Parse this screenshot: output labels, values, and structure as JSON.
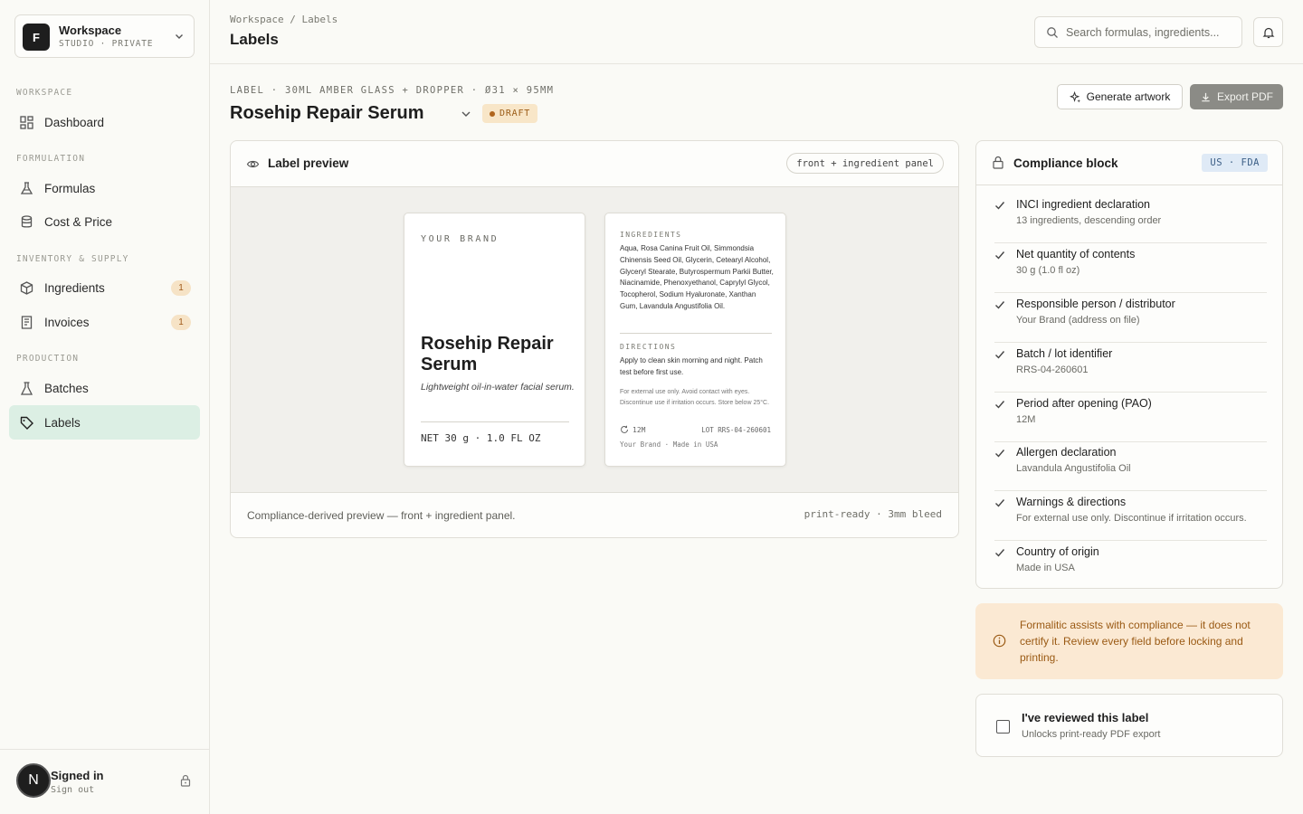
{
  "workspace": {
    "logo_letter": "F",
    "name": "Workspace",
    "subtitle": "STUDIO · PRIVATE"
  },
  "sidebar": {
    "sections": [
      {
        "label": "WORKSPACE"
      },
      {
        "label": "FORMULATION"
      },
      {
        "label": "INVENTORY & SUPPLY"
      },
      {
        "label": "PRODUCTION"
      }
    ],
    "items": [
      {
        "label": "Dashboard",
        "icon": "grid-icon"
      },
      {
        "label": "Formulas",
        "icon": "flask-icon"
      },
      {
        "label": "Cost & Price",
        "icon": "database-icon"
      },
      {
        "label": "Ingredients",
        "icon": "box-icon",
        "badge": "1"
      },
      {
        "label": "Invoices",
        "icon": "receipt-icon",
        "badge": "1"
      },
      {
        "label": "Batches",
        "icon": "beaker-icon"
      },
      {
        "label": "Labels",
        "icon": "tag-icon",
        "active": true
      }
    ],
    "footer": {
      "avatar_letter": "N",
      "status": "Signed in",
      "action": "Sign out"
    }
  },
  "header": {
    "breadcrumb": "Workspace / Labels",
    "title": "Labels",
    "search_placeholder": "Search formulas, ingredients..."
  },
  "label": {
    "meta": "LABEL · 30ML AMBER GLASS + DROPPER · Ø31 × 95MM",
    "name": "Rosehip Repair Serum",
    "status": "DRAFT",
    "generate_label": "Generate artwork",
    "export_label": "Export PDF"
  },
  "preview": {
    "title": "Label preview",
    "pill": "front + ingredient panel",
    "front": {
      "brand": "YOUR BRAND",
      "product": "Rosehip Repair Serum",
      "description": "Lightweight oil-in-water facial serum.",
      "net": "NET 30 g · 1.0 FL OZ"
    },
    "back": {
      "ingredients_heading": "INGREDIENTS",
      "ingredients": "Aqua, Rosa Canina Fruit Oil, Simmondsia Chinensis Seed Oil, Glycerin, Cetearyl Alcohol, Glyceryl Stearate, Butyrospermum Parkii Butter, Niacinamide, Phenoxyethanol, Caprylyl Glycol, Tocopherol, Sodium Hyaluronate, Xanthan Gum, Lavandula Angustifolia Oil.",
      "directions_heading": "DIRECTIONS",
      "directions": "Apply to clean skin morning and night. Patch test before first use.",
      "warnings": "For external use only. Avoid contact with eyes. Discontinue use if irritation occurs. Store below 25°C.",
      "pao": "12M",
      "lot": "LOT RRS-04-260601",
      "made": "Your Brand · Made in USA"
    },
    "footer_left": "Compliance-derived preview — front + ingredient panel.",
    "footer_right": "print-ready · 3mm bleed"
  },
  "compliance": {
    "title": "Compliance block",
    "region": "US · FDA",
    "items": [
      {
        "title": "INCI ingredient declaration",
        "sub": "13 ingredients, descending order"
      },
      {
        "title": "Net quantity of contents",
        "sub": "30 g (1.0 fl oz)"
      },
      {
        "title": "Responsible person / distributor",
        "sub": "Your Brand (address on file)"
      },
      {
        "title": "Batch / lot identifier",
        "sub": "RRS-04-260601"
      },
      {
        "title": "Period after opening (PAO)",
        "sub": "12M"
      },
      {
        "title": "Allergen declaration",
        "sub": "Lavandula Angustifolia Oil"
      },
      {
        "title": "Warnings & directions",
        "sub": "For external use only. Discontinue if irritation occurs."
      },
      {
        "title": "Country of origin",
        "sub": "Made in USA"
      }
    ]
  },
  "notice": {
    "text": "Formalitic assists with compliance — it does not certify it. Review every field before locking and printing."
  },
  "review": {
    "title": "I've reviewed this label",
    "sub": "Unlocks print-ready PDF export",
    "checked": false
  },
  "colors": {
    "accent_active": "#dcefe4",
    "draft": "#f8e6c8",
    "notice": "#fbe9d3",
    "region": "#dfeaf6"
  }
}
